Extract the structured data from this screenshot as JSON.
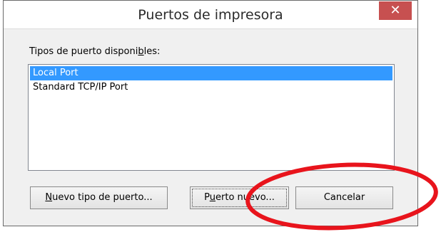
{
  "window": {
    "title": "Puertos de impresora",
    "close_glyph": "✕"
  },
  "port_types": {
    "label_before": "Tipos de puerto disponi",
    "label_mnemonic": "b",
    "label_after": "les:",
    "items": [
      {
        "label": "Local Port",
        "selected": true
      },
      {
        "label": "Standard TCP/IP Port",
        "selected": false
      }
    ]
  },
  "buttons": {
    "new_type_mnemonic": "N",
    "new_type_rest": "uevo tipo de puerto...",
    "new_port_before": "P",
    "new_port_mnemonic": "u",
    "new_port_after": "erto nuevo...",
    "cancel": "Cancelar"
  },
  "colors": {
    "selection": "#3399ff",
    "close_button": "#c75050",
    "annotation_circle": "#e8141c"
  },
  "icons": {
    "close": "close-icon"
  }
}
